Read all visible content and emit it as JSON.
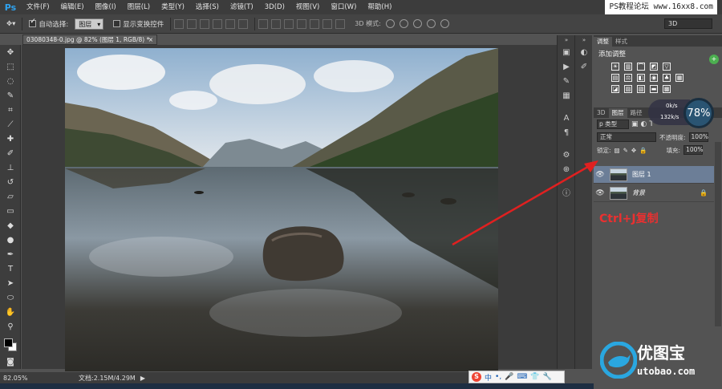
{
  "menubar": {
    "logo": "Ps",
    "items": [
      "文件(F)",
      "编辑(E)",
      "图像(I)",
      "图层(L)",
      "类型(Y)",
      "选择(S)",
      "滤镜(T)",
      "3D(D)",
      "视图(V)",
      "窗口(W)",
      "帮助(H)"
    ],
    "watermark": "PS教程论坛 www.16xx8.com"
  },
  "options": {
    "auto_select_label": "自动选择:",
    "auto_select_value": "图层",
    "show_transform_label": "显示变换控件",
    "mode_label": "3D 模式:",
    "workspace": "3D"
  },
  "document": {
    "tab_title": "03080348-0.jpg @ 82% (图层 1, RGB/8) *",
    "tab_close": "×"
  },
  "status": {
    "zoom": "82.05%",
    "doc_size": "文档:2.15M/4.29M"
  },
  "ime": {
    "logo": "S",
    "lang": "中"
  },
  "panels": {
    "top_tabs": [
      "调整",
      "样式"
    ],
    "adjust_title": "添加调整",
    "layers_tabs": [
      "3D",
      "图层",
      "路径"
    ],
    "filter_kind": "p 类型",
    "blend_mode": "正常",
    "opacity_label": "不透明度:",
    "opacity_value": "100%",
    "lock_label": "锁定:",
    "fill_label": "填充:",
    "fill_value": "100%",
    "layers": [
      {
        "name": "图层 1",
        "selected": true
      },
      {
        "name": "背景",
        "selected": false,
        "locked": true
      }
    ]
  },
  "net_monitor": {
    "percent": "78%",
    "up": "0k/s",
    "down": "132k/s"
  },
  "annotation": {
    "text": "Ctrl+J复制",
    "color": "#ea3030"
  },
  "brand": {
    "name": "优图宝",
    "url": "utobao.com"
  },
  "colors": {
    "ui_dark": "#3c3c3c",
    "panel": "#535353",
    "selected_layer": "#6c7e97",
    "ps_blue": "#2fa3f0",
    "arrow_red": "#e02020"
  }
}
